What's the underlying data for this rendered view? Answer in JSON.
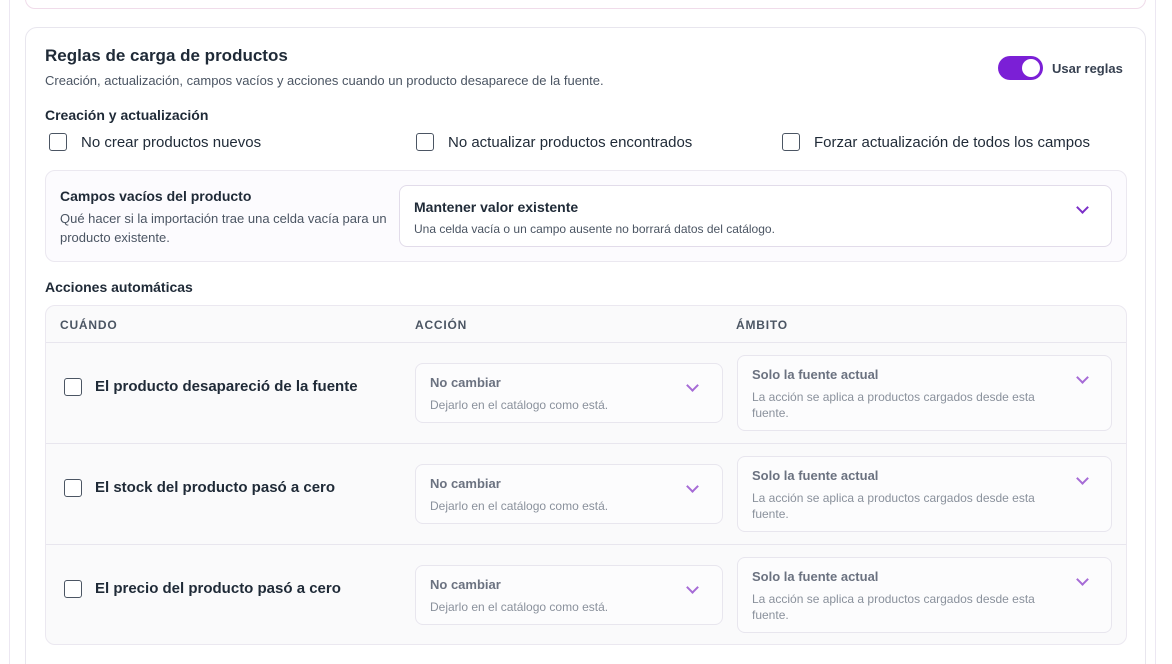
{
  "section": {
    "title": "Reglas de carga de productos",
    "subtitle": "Creación, actualización, campos vacíos y acciones cuando un producto desaparece de la fuente.",
    "toggle_label": "Usar reglas",
    "toggle_on": true,
    "accent_color": "#7b1fd6"
  },
  "creation": {
    "heading": "Creación y actualización",
    "options": [
      {
        "label": "No crear productos nuevos",
        "checked": false
      },
      {
        "label": "No actualizar productos encontrados",
        "checked": false
      },
      {
        "label": "Forzar actualización de todos los campos",
        "checked": false
      }
    ]
  },
  "empty_fields": {
    "title": "Campos vacíos del producto",
    "description": "Qué hacer si la importación trae una celda vacía para un producto existente.",
    "select": {
      "value": "Mantener valor existente",
      "hint": "Una celda vacía o un campo ausente no borrará datos del catálogo.",
      "icon": "chevron-down-icon"
    }
  },
  "auto_actions": {
    "heading": "Acciones automáticas",
    "columns": [
      "CUÁNDO",
      "ACCIÓN",
      "ÁMBITO"
    ],
    "rows": [
      {
        "when": "El producto desapareció de la fuente",
        "checked": false,
        "action": {
          "value": "No cambiar",
          "hint": "Dejarlo en el catálogo como está."
        },
        "scope": {
          "value": "Solo la fuente actual",
          "hint": "La acción se aplica a productos cargados desde esta fuente."
        }
      },
      {
        "when": "El stock del producto pasó a cero",
        "checked": false,
        "action": {
          "value": "No cambiar",
          "hint": "Dejarlo en el catálogo como está."
        },
        "scope": {
          "value": "Solo la fuente actual",
          "hint": "La acción se aplica a productos cargados desde esta fuente."
        }
      },
      {
        "when": "El precio del producto pasó a cero",
        "checked": false,
        "action": {
          "value": "No cambiar",
          "hint": "Dejarlo en el catálogo como está."
        },
        "scope": {
          "value": "Solo la fuente actual",
          "hint": "La acción se aplica a productos cargados desde esta fuente."
        }
      }
    ]
  }
}
